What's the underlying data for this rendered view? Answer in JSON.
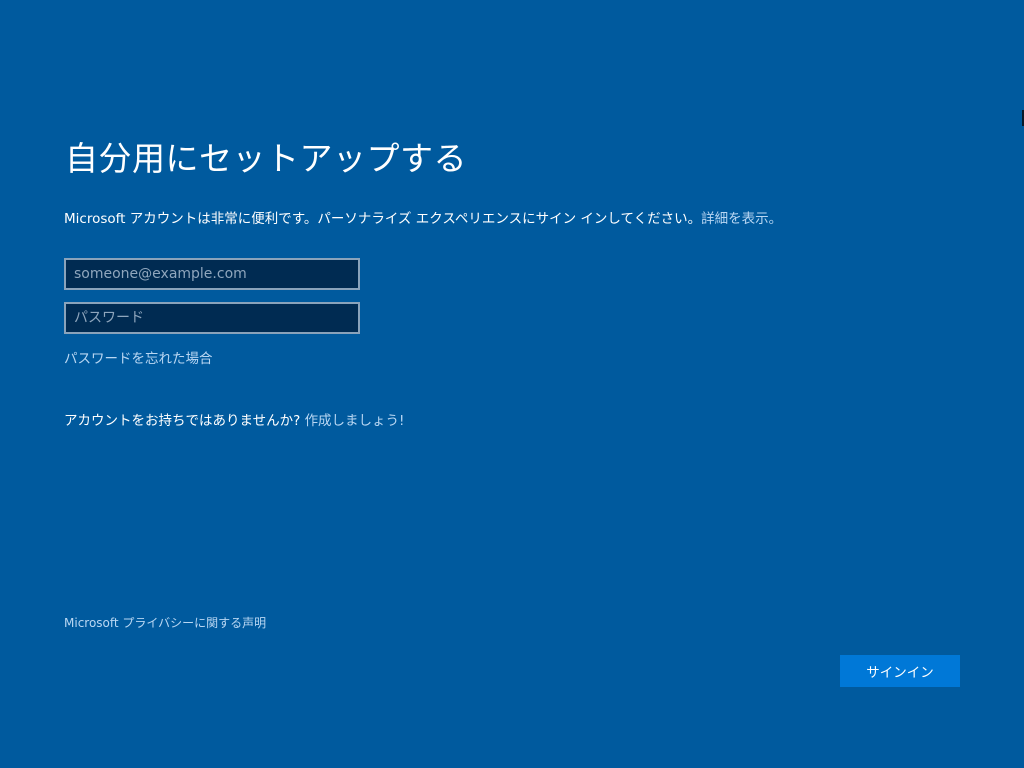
{
  "title": "自分用にセットアップする",
  "intro": {
    "text": "Microsoft アカウントは非常に便利です。パーソナライズ エクスペリエンスにサイン インしてください。",
    "link": "詳細を表示。"
  },
  "email_field": {
    "placeholder": "someone@example.com",
    "value": ""
  },
  "password_field": {
    "placeholder": "パスワード",
    "value": ""
  },
  "forgot_password": "パスワードを忘れた場合",
  "no_account": {
    "text": "アカウントをお持ちではありませんか? ",
    "link": "作成しましょう!"
  },
  "privacy_link": "Microsoft プライバシーに関する声明",
  "signin_button": "サインイン",
  "colors": {
    "background": "#005a9e",
    "input_background": "#002b52",
    "input_border": "#8aa3bb",
    "link": "#b9d7f3",
    "button": "#0078d7",
    "text": "#ffffff"
  }
}
